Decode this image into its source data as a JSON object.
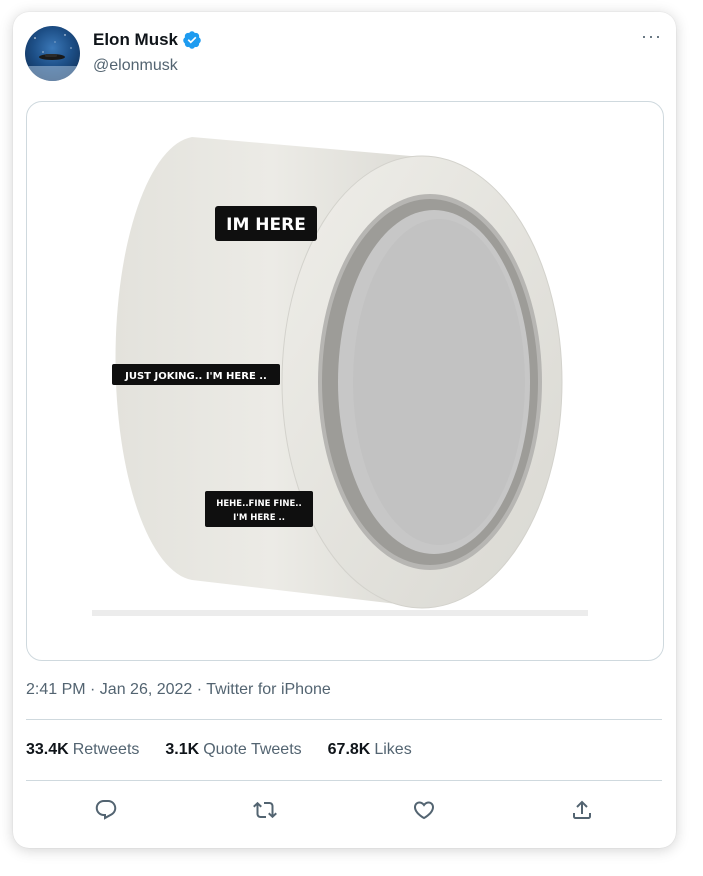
{
  "tweet": {
    "author_name": "Elon Musk",
    "author_handle": "@elonmusk",
    "timestamp_line": "2:41 PM · Jan 26, 2022 · Twitter for iPhone",
    "more_label": "···"
  },
  "image": {
    "caption_1": "IM HERE",
    "caption_2": "JUST JOKING.. I'M HERE ..",
    "caption_3_line_1": "HEHE..FINE FINE..",
    "caption_3_line_2": "I'M HERE .."
  },
  "stats": {
    "retweets_count": "33.4K",
    "retweets_label": "Retweets",
    "quotes_count": "3.1K",
    "quotes_label": "Quote Tweets",
    "likes_count": "67.8K",
    "likes_label": "Likes"
  },
  "colors": {
    "verified_blue": "#1d9bf0",
    "secondary_text": "#536471",
    "divider": "#cfd9de"
  },
  "icons": [
    "reply-icon",
    "retweet-icon",
    "like-icon",
    "share-icon",
    "verified-badge-icon",
    "more-icon"
  ]
}
